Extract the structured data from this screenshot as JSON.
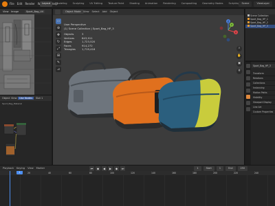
{
  "topbar": {
    "menu": [
      "File",
      "Edit",
      "Render",
      "Window",
      "Help"
    ],
    "tabs": [
      {
        "label": "Layout",
        "active": true
      },
      {
        "label": "Modeling"
      },
      {
        "label": "Sculpting"
      },
      {
        "label": "UV Editing"
      },
      {
        "label": "Texture Paint"
      },
      {
        "label": "Shading"
      },
      {
        "label": "Animation"
      },
      {
        "label": "Rendering"
      },
      {
        "label": "Compositing"
      },
      {
        "label": "Geometry Nodes"
      },
      {
        "label": "Scripting"
      }
    ],
    "scene": "Scene",
    "view_layer": "ViewLayer"
  },
  "viewport": {
    "mode": "Object Mode",
    "menu": [
      "View",
      "Select",
      "Add",
      "Object"
    ],
    "perspective": "User Perspective",
    "collection": "(1) Scene Collection | Sport_Bag_HP_3",
    "stats": [
      {
        "key": "Objects",
        "value": "3"
      },
      {
        "key": "Vertices",
        "value": "843,911"
      },
      {
        "key": "Edges",
        "value": "1,723,520"
      },
      {
        "key": "Faces",
        "value": "914,272"
      },
      {
        "key": "Triangles",
        "value": "1,719,416"
      }
    ],
    "gizmo": {
      "x": "X",
      "y": "Y",
      "z": "Z"
    },
    "colors": {
      "bag_gray": "#6e757d",
      "bag_orange": "#e0701e",
      "bag_blue": "#2b5f7e",
      "bag_yellow": "#c9cc3c"
    }
  },
  "outliner": {
    "rows": [
      {
        "label": "Scene Collection",
        "selected": false
      },
      {
        "label": "Sport_Bag_HP_1",
        "selected": false
      },
      {
        "label": "Sport_Bag_HP_2",
        "selected": false
      },
      {
        "label": "Sport_Bag_HP_3",
        "selected": true
      }
    ]
  },
  "properties": {
    "object_name": "Sport_Bag_HP_3",
    "sections": [
      "Transform",
      "Relations",
      "Collections",
      "Instancing",
      "Motion Paths",
      "Visibility",
      "Viewport Display",
      "Line Art",
      "Custom Properties"
    ]
  },
  "uv_editor": {
    "image": "Sport_Bag_UV",
    "menu": [
      "View",
      "Image"
    ]
  },
  "node_editor": {
    "type": "Object",
    "menu": [
      "View",
      "Select",
      "Add",
      "Node"
    ],
    "use_nodes": "Use Nodes",
    "material": "Sport_Bag_Material",
    "slot": "Slot 1"
  },
  "timeline": {
    "menu": [
      "Playback",
      "Keying",
      "View",
      "Marker"
    ],
    "current_frame": "1",
    "start_label": "Start",
    "start": "1",
    "end_label": "End",
    "end": "250",
    "ruler": [
      "20",
      "40",
      "60",
      "80",
      "100",
      "120",
      "140",
      "160",
      "180",
      "200",
      "220",
      "240"
    ]
  }
}
